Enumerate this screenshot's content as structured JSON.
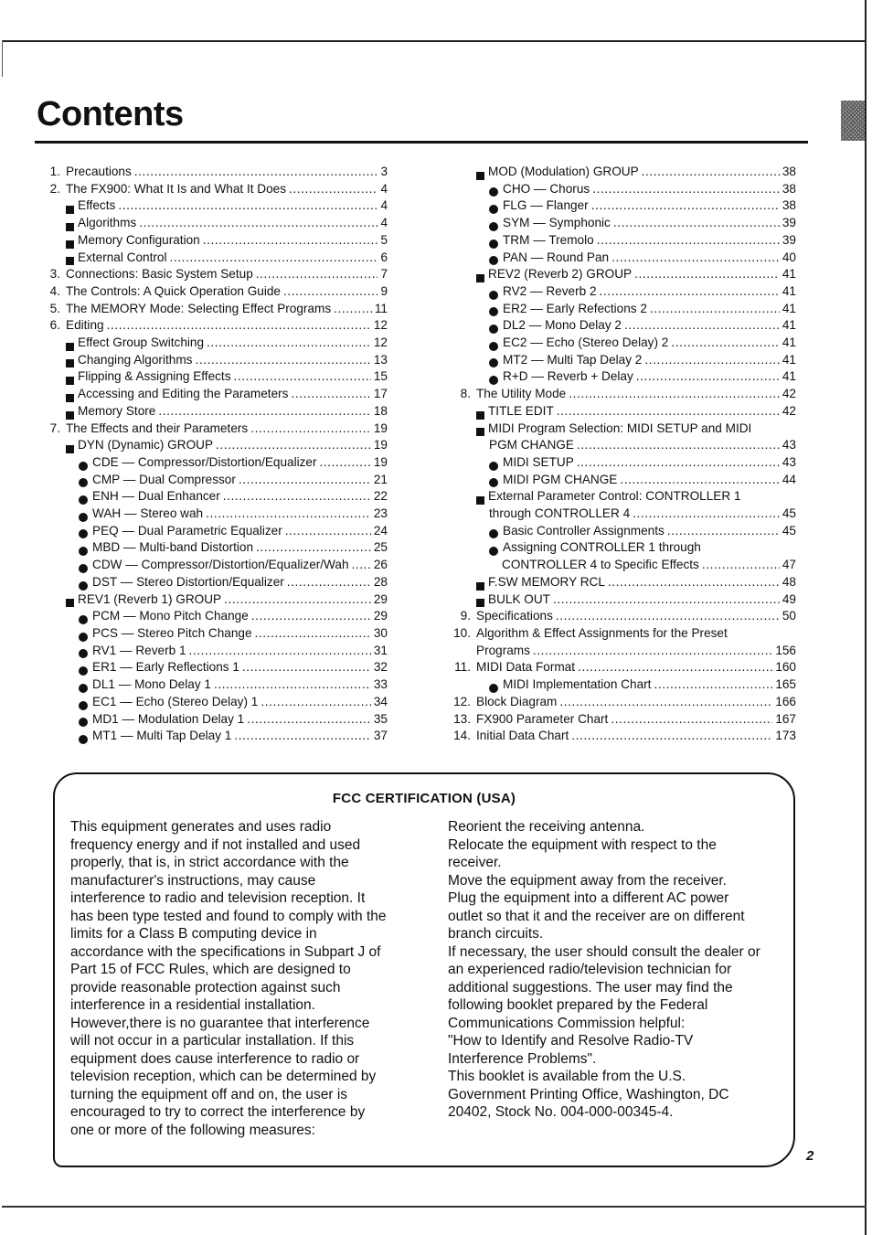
{
  "header": {
    "title": "Contents"
  },
  "toc": {
    "left": [
      {
        "level": "l1",
        "marker": "1.",
        "text": "Precautions",
        "page": "3"
      },
      {
        "level": "l1",
        "marker": "2.",
        "text": "The FX900: What It Is and What It Does",
        "page": "4"
      },
      {
        "level": "l2",
        "marker": "square",
        "text": "Effects",
        "page": "4"
      },
      {
        "level": "l2",
        "marker": "square",
        "text": "Algorithms",
        "page": "4"
      },
      {
        "level": "l2",
        "marker": "square",
        "text": "Memory Configuration",
        "page": "5"
      },
      {
        "level": "l2",
        "marker": "square",
        "text": "External Control",
        "page": "6"
      },
      {
        "level": "l1",
        "marker": "3.",
        "text": "Connections: Basic System Setup",
        "page": "7"
      },
      {
        "level": "l1",
        "marker": "4.",
        "text": "The Controls: A Quick Operation Guide",
        "page": "9"
      },
      {
        "level": "l1",
        "marker": "5.",
        "text": "The MEMORY Mode: Selecting Effect Programs",
        "page": "11"
      },
      {
        "level": "l1",
        "marker": "6.",
        "text": "Editing",
        "page": "12"
      },
      {
        "level": "l2",
        "marker": "square",
        "text": "Effect Group Switching",
        "page": "12"
      },
      {
        "level": "l2",
        "marker": "square",
        "text": "Changing Algorithms",
        "page": "13"
      },
      {
        "level": "l2",
        "marker": "square",
        "text": "Flipping & Assigning Effects",
        "page": "15"
      },
      {
        "level": "l2",
        "marker": "square",
        "text": "Accessing and Editing the Parameters",
        "page": "17"
      },
      {
        "level": "l2",
        "marker": "square",
        "text": "Memory Store",
        "page": "18"
      },
      {
        "level": "l1",
        "marker": "7.",
        "text": "The Effects and their Parameters",
        "page": "19"
      },
      {
        "level": "l2",
        "marker": "square",
        "text": "DYN (Dynamic) GROUP",
        "page": "19"
      },
      {
        "level": "l3",
        "marker": "bullet",
        "text": "CDE — Compressor/Distortion/Equalizer",
        "page": "19"
      },
      {
        "level": "l3",
        "marker": "bullet",
        "text": "CMP — Dual Compressor",
        "page": "21"
      },
      {
        "level": "l3",
        "marker": "bullet",
        "text": "ENH — Dual Enhancer",
        "page": "22"
      },
      {
        "level": "l3",
        "marker": "bullet",
        "text": "WAH — Stereo wah",
        "page": "23"
      },
      {
        "level": "l3",
        "marker": "bullet",
        "text": "PEQ — Dual Parametric Equalizer",
        "page": "24"
      },
      {
        "level": "l3",
        "marker": "bullet",
        "text": "MBD — Multi-band Distortion",
        "page": "25"
      },
      {
        "level": "l3",
        "marker": "bullet",
        "text": "CDW — Compressor/Distortion/Equalizer/Wah",
        "page": "26"
      },
      {
        "level": "l3",
        "marker": "bullet",
        "text": "DST — Stereo Distortion/Equalizer",
        "page": "28"
      },
      {
        "level": "l2",
        "marker": "square",
        "text": "REV1 (Reverb 1) GROUP",
        "page": "29"
      },
      {
        "level": "l3",
        "marker": "bullet",
        "text": "PCM — Mono Pitch Change",
        "page": "29"
      },
      {
        "level": "l3",
        "marker": "bullet",
        "text": "PCS — Stereo Pitch Change",
        "page": "30"
      },
      {
        "level": "l3",
        "marker": "bullet",
        "text": "RV1 — Reverb 1",
        "page": "31"
      },
      {
        "level": "l3",
        "marker": "bullet",
        "text": "ER1 — Early Reflections 1",
        "page": "32"
      },
      {
        "level": "l3",
        "marker": "bullet",
        "text": "DL1 — Mono Delay 1",
        "page": "33"
      },
      {
        "level": "l3",
        "marker": "bullet",
        "text": "EC1 — Echo (Stereo Delay) 1",
        "page": "34"
      },
      {
        "level": "l3",
        "marker": "bullet",
        "text": "MD1 — Modulation Delay 1",
        "page": "35"
      },
      {
        "level": "l3",
        "marker": "bullet",
        "text": "MT1 — Multi Tap Delay 1",
        "page": "37"
      }
    ],
    "right": [
      {
        "level": "l2",
        "marker": "square",
        "text": "MOD (Modulation) GROUP",
        "page": "38"
      },
      {
        "level": "l3",
        "marker": "bullet",
        "text": "CHO — Chorus",
        "page": "38"
      },
      {
        "level": "l3",
        "marker": "bullet",
        "text": "FLG — Flanger",
        "page": "38"
      },
      {
        "level": "l3",
        "marker": "bullet",
        "text": "SYM — Symphonic",
        "page": "39"
      },
      {
        "level": "l3",
        "marker": "bullet",
        "text": "TRM — Tremolo",
        "page": "39"
      },
      {
        "level": "l3",
        "marker": "bullet",
        "text": "PAN — Round Pan",
        "page": "40"
      },
      {
        "level": "l2",
        "marker": "square",
        "text": "REV2 (Reverb 2) GROUP",
        "page": "41"
      },
      {
        "level": "l3",
        "marker": "bullet",
        "text": "RV2 — Reverb 2",
        "page": "41"
      },
      {
        "level": "l3",
        "marker": "bullet",
        "text": "ER2 — Early Refections 2",
        "page": "41"
      },
      {
        "level": "l3",
        "marker": "bullet",
        "text": "DL2 — Mono Delay 2",
        "page": "41"
      },
      {
        "level": "l3",
        "marker": "bullet",
        "text": "EC2 — Echo (Stereo Delay) 2",
        "page": "41"
      },
      {
        "level": "l3",
        "marker": "bullet",
        "text": "MT2 — Multi Tap Delay 2",
        "page": "41"
      },
      {
        "level": "l3",
        "marker": "bullet",
        "text": "R+D — Reverb + Delay",
        "page": "41"
      },
      {
        "level": "l1",
        "marker": "8.",
        "text": "The Utility Mode",
        "page": "42"
      },
      {
        "level": "l2",
        "marker": "square",
        "text": "TITLE EDIT",
        "page": "42"
      },
      {
        "level": "l2",
        "marker": "square",
        "text": "MIDI Program Selection: MIDI SETUP and MIDI",
        "page": ""
      },
      {
        "level": "l2c",
        "marker": "",
        "text": "PGM CHANGE",
        "page": "43"
      },
      {
        "level": "l3",
        "marker": "bullet",
        "text": "MIDI SETUP",
        "page": "43"
      },
      {
        "level": "l3",
        "marker": "bullet",
        "text": "MIDI PGM CHANGE",
        "page": "44"
      },
      {
        "level": "l2",
        "marker": "square",
        "text": "External Parameter Control: CONTROLLER 1",
        "page": ""
      },
      {
        "level": "l2c",
        "marker": "",
        "text": "through CONTROLLER 4",
        "page": "45"
      },
      {
        "level": "l3",
        "marker": "bullet",
        "text": "Basic Controller Assignments",
        "page": "45"
      },
      {
        "level": "l3",
        "marker": "bullet",
        "text": "Assigning CONTROLLER 1 through",
        "page": ""
      },
      {
        "level": "l3c",
        "marker": "",
        "text": "CONTROLLER 4 to Specific Effects",
        "page": "47"
      },
      {
        "level": "l2",
        "marker": "square",
        "text": "F.SW MEMORY RCL",
        "page": "48"
      },
      {
        "level": "l2",
        "marker": "square",
        "text": "BULK OUT",
        "page": "49"
      },
      {
        "level": "l1",
        "marker": "9.",
        "text": "Specifications",
        "page": "50"
      },
      {
        "level": "l1",
        "marker": "10.",
        "text": "Algorithm & Effect Assignments for the Preset",
        "page": ""
      },
      {
        "level": "l1c",
        "marker": "",
        "text": "Programs",
        "page": "156"
      },
      {
        "level": "l1",
        "marker": "11.",
        "text": "MIDI Data Format",
        "page": "160"
      },
      {
        "level": "l3i",
        "marker": "bullet",
        "text": "MIDI Implementation Chart",
        "page": "165"
      },
      {
        "level": "l1",
        "marker": "12.",
        "text": "Block Diagram",
        "page": "166"
      },
      {
        "level": "l1",
        "marker": "13.",
        "text": "FX900 Parameter Chart",
        "page": "167"
      },
      {
        "level": "l1",
        "marker": "14.",
        "text": "Initial Data Chart",
        "page": "173"
      }
    ]
  },
  "fcc": {
    "title": "FCC CERTIFICATION (USA)",
    "left_lines": [
      "This equipment generates and uses radio",
      "frequency energy and if not installed and used",
      "properly, that is, in strict accordance with the",
      "manufacturer's instructions, may cause",
      "interference to radio and television reception. It",
      "has been type tested and found to comply with the",
      "limits for a Class B computing device in",
      "accordance with the specifications in Subpart J of",
      "Part 15 of FCC Rules, which are designed to",
      "provide reasonable protection against such",
      "interference in a residential installation.",
      "However,there is no guarantee that interference",
      "will not occur in a particular installation. If this",
      "equipment does cause interference to radio or",
      "television reception, which can be determined by",
      "turning the equipment off and on, the user is",
      "encouraged to try to correct the interference by",
      "one or more of the following measures:"
    ],
    "right_lines": [
      "Reorient the receiving antenna.",
      "Relocate the equipment with respect to the",
      "receiver.",
      "Move the equipment away from the receiver.",
      "Plug the equipment into a different AC power",
      "outlet so that it and the receiver are on different",
      "branch circuits.",
      "If necessary, the user should consult the dealer or",
      "an experienced radio/television technician for",
      "additional suggestions. The user may find the",
      "following booklet prepared by the Federal",
      "Communications Commission helpful:",
      "\"How to Identify and Resolve Radio-TV",
      "Interference Problems\".",
      "This booklet  is available from the U.S.",
      "Government Printing Office, Washington, DC",
      "20402, Stock No. 004-000-00345-4."
    ]
  },
  "footer": {
    "page_number": "2"
  }
}
